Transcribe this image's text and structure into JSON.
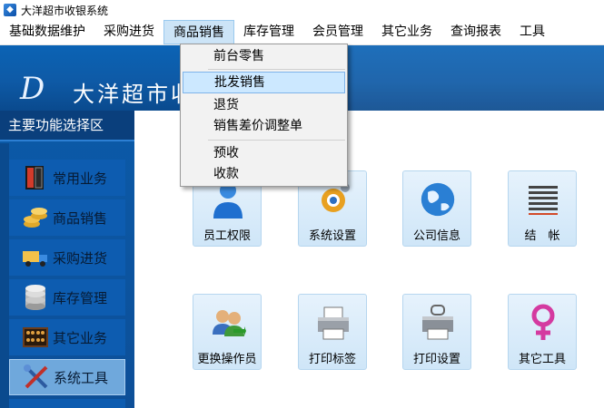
{
  "window": {
    "title": "大洋超市收银系统"
  },
  "menubar": {
    "items": [
      {
        "label": "基础数据维护"
      },
      {
        "label": "采购进货"
      },
      {
        "label": "商品销售"
      },
      {
        "label": "库存管理"
      },
      {
        "label": "会员管理"
      },
      {
        "label": "其它业务"
      },
      {
        "label": "查询报表"
      },
      {
        "label": "工具"
      }
    ],
    "active_index": 2
  },
  "banner": {
    "logo_letter": "D",
    "brand": "大洋超市收银系统"
  },
  "sidebar": {
    "header": "主要功能选择区",
    "items": [
      {
        "label": "常用业务",
        "icon": "book-icon"
      },
      {
        "label": "商品销售",
        "icon": "coins-icon"
      },
      {
        "label": "采购进货",
        "icon": "truck-icon"
      },
      {
        "label": "库存管理",
        "icon": "database-icon"
      },
      {
        "label": "其它业务",
        "icon": "abacus-icon"
      },
      {
        "label": "系统工具",
        "icon": "tools-icon",
        "selected": true
      }
    ]
  },
  "tiles": [
    {
      "label": "员工权限",
      "icon": "user-icon"
    },
    {
      "label": "系统设置",
      "icon": "gear-icon"
    },
    {
      "label": "公司信息",
      "icon": "globe-icon"
    },
    {
      "label": "结　帐",
      "icon": "ledger-icon"
    },
    {
      "label": "更换操作员",
      "icon": "switch-user-icon"
    },
    {
      "label": "打印标签",
      "icon": "printer-icon"
    },
    {
      "label": "打印设置",
      "icon": "printer-lock-icon"
    },
    {
      "label": "其它工具",
      "icon": "female-symbol-icon"
    }
  ],
  "dropdown": {
    "items": [
      {
        "label": "前台零售"
      },
      {
        "label": "批发销售",
        "hover": true
      },
      {
        "label": "退货"
      },
      {
        "label": "销售差价调整单"
      },
      {
        "label": "预收"
      },
      {
        "label": "收款"
      }
    ]
  },
  "colors": {
    "banner_blue": "#0b63b5",
    "sidebar_blue": "#0d4f98",
    "menu_highlight": "#cce4f7",
    "tile_bg": "#dcecfa"
  }
}
